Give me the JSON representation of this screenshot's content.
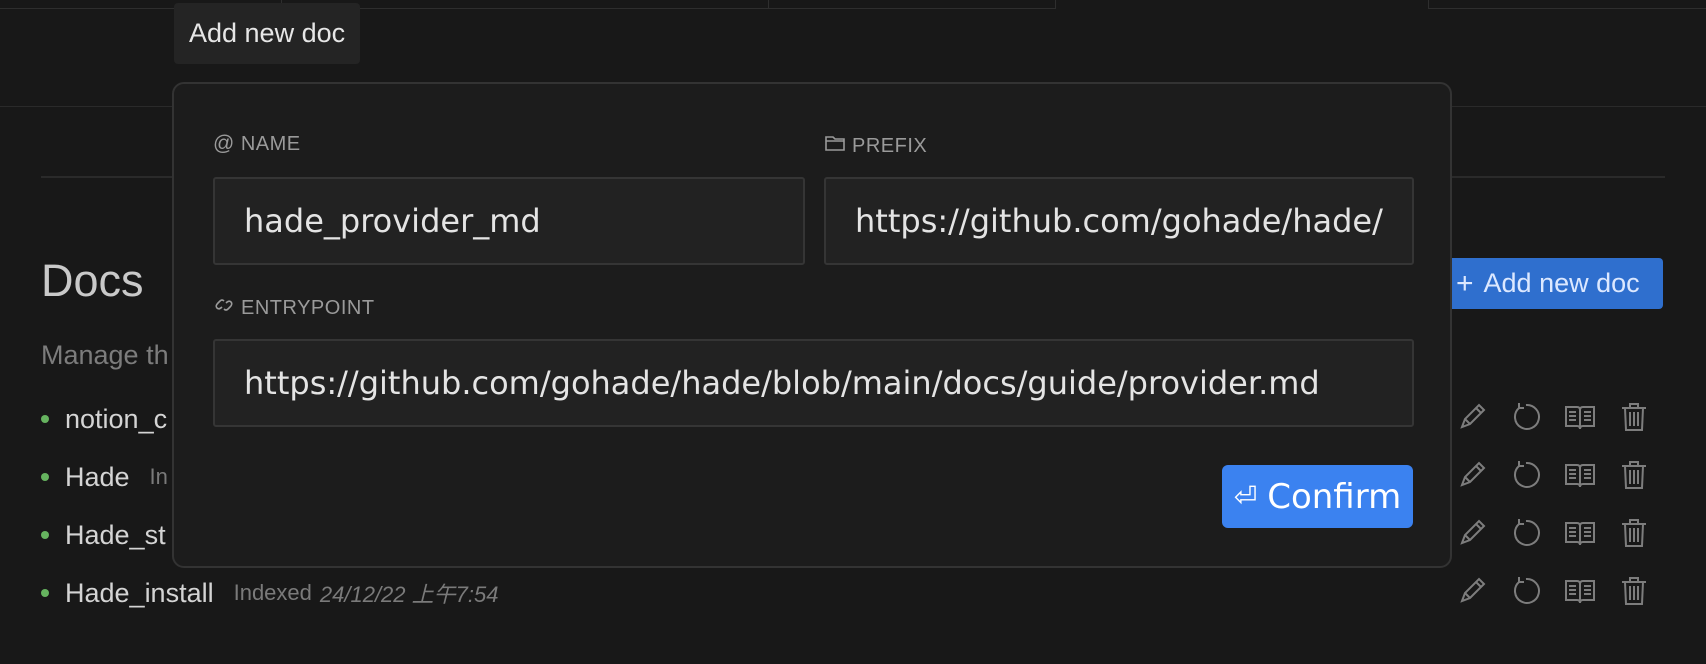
{
  "tooltip": {
    "text": "Add new doc"
  },
  "page": {
    "title": "Docs",
    "subtitle": "Manage th",
    "add_button": {
      "label": "Add new doc",
      "icon": "plus-icon"
    }
  },
  "docs": [
    {
      "name": "notion_c",
      "status": "",
      "date": ""
    },
    {
      "name": "Hade",
      "status": "In",
      "date": ""
    },
    {
      "name": "Hade_st",
      "status": "",
      "date": ""
    },
    {
      "name": "Hade_install",
      "status": "Indexed",
      "date": "24/12/22 上午7:54"
    }
  ],
  "row_actions": [
    "pencil-icon",
    "refresh-icon",
    "book-icon",
    "trash-icon"
  ],
  "modal": {
    "name": {
      "label": "NAME",
      "icon": "at-icon",
      "value": "hade_provider_md"
    },
    "prefix": {
      "label": "PREFIX",
      "icon": "folder-icon",
      "value": "https://github.com/gohade/hade/blob/main/docs/guide/"
    },
    "entrypoint": {
      "label": "ENTRYPOINT",
      "icon": "link-icon",
      "value": "https://github.com/gohade/hade/blob/main/docs/guide/provider.md"
    },
    "confirm": {
      "label": "Confirm",
      "icon": "return-icon"
    }
  },
  "colors": {
    "background": "#181818",
    "accent": "#3b82f0",
    "add_button": "#2f6fce",
    "status_dot": "#66b35f"
  }
}
